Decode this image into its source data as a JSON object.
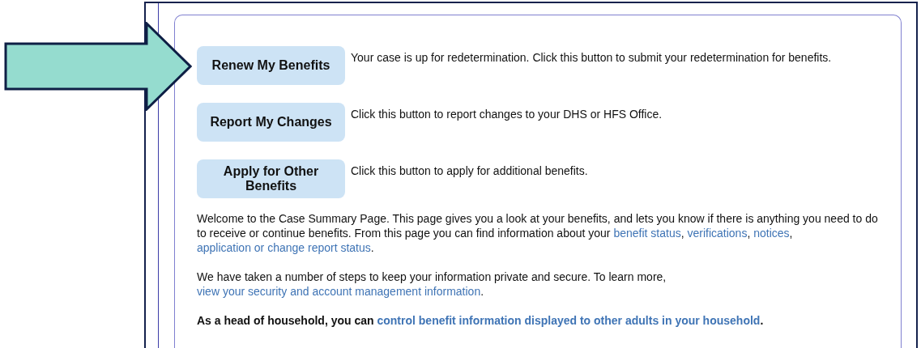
{
  "actions": [
    {
      "label": "Renew My Benefits",
      "description": "Your case is up for redetermination. Click this button to submit your redetermination for benefits."
    },
    {
      "label": "Report My Changes",
      "description": "Click this button to report changes to your DHS or HFS Office."
    },
    {
      "label": "Apply for Other Benefits",
      "description": "Click this button to apply for additional benefits."
    }
  ],
  "paragraphs": [
    {
      "bold": false,
      "parts": [
        {
          "kind": "text",
          "text": "Welcome to the Case Summary Page. This page gives you a look at your benefits, and lets you know if there is anything you need to do to receive or continue benefits. From this page you can find information about your "
        },
        {
          "kind": "link",
          "text": "benefit status"
        },
        {
          "kind": "text",
          "text": ", "
        },
        {
          "kind": "link",
          "text": "verifications"
        },
        {
          "kind": "text",
          "text": ", "
        },
        {
          "kind": "link",
          "text": "notices"
        },
        {
          "kind": "text",
          "text": ", "
        },
        {
          "kind": "link",
          "text": "application or change report status"
        },
        {
          "kind": "text",
          "text": "."
        }
      ]
    },
    {
      "bold": false,
      "parts": [
        {
          "kind": "text",
          "text": "We have taken a number of steps to keep your information private and secure. To learn more, "
        },
        {
          "kind": "link",
          "text": "view your security and account management information"
        },
        {
          "kind": "text",
          "text": "."
        }
      ]
    },
    {
      "bold": true,
      "parts": [
        {
          "kind": "text",
          "text": "As a head of household, you can "
        },
        {
          "kind": "link",
          "text": "control benefit information displayed to other adults in your household"
        },
        {
          "kind": "text",
          "text": "."
        }
      ]
    }
  ]
}
